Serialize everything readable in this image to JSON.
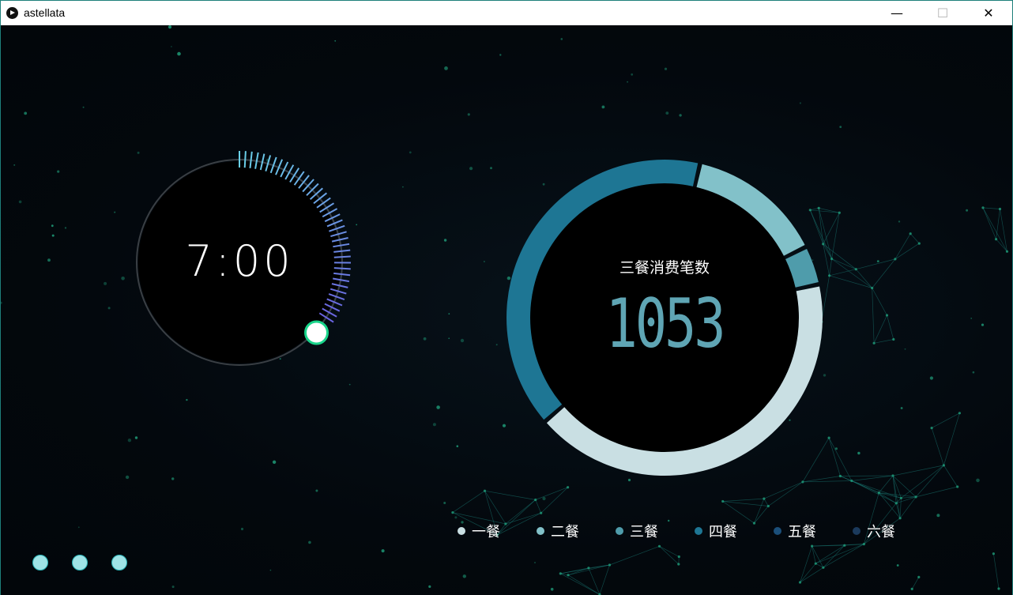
{
  "window": {
    "title": "astellata",
    "controls": {
      "minimize": "—",
      "maximize": "☐",
      "close": "✕"
    }
  },
  "clock": {
    "time": "7:00",
    "progress": 0.34,
    "colors": {
      "track": "#3a3f44",
      "tick_start": "#6ad1e8",
      "tick_end": "#6a63e0",
      "knob_fill": "#ffffff",
      "knob_ring": "#19d48a"
    }
  },
  "donut": {
    "title": "三餐消费笔数",
    "value": "1053"
  },
  "chart_data": {
    "type": "pie",
    "title": "三餐消费笔数",
    "center_value": 1053,
    "categories": [
      "一餐",
      "二餐",
      "三餐",
      "四餐",
      "五餐",
      "六餐"
    ],
    "values": [
      42,
      14,
      4,
      40,
      0,
      0
    ],
    "unit": "%",
    "colors": [
      "#c9dfe3",
      "#82c1c9",
      "#4f9cab",
      "#1e7694",
      "#1b4f7a",
      "#1b3a5c"
    ],
    "legend_position": "bottom"
  },
  "pager": {
    "dots": [
      "page-1",
      "page-2",
      "page-3"
    ]
  },
  "background": {
    "base": "#03080d",
    "node_color": "#1f9e7a",
    "line_color": "#1a7a74"
  }
}
